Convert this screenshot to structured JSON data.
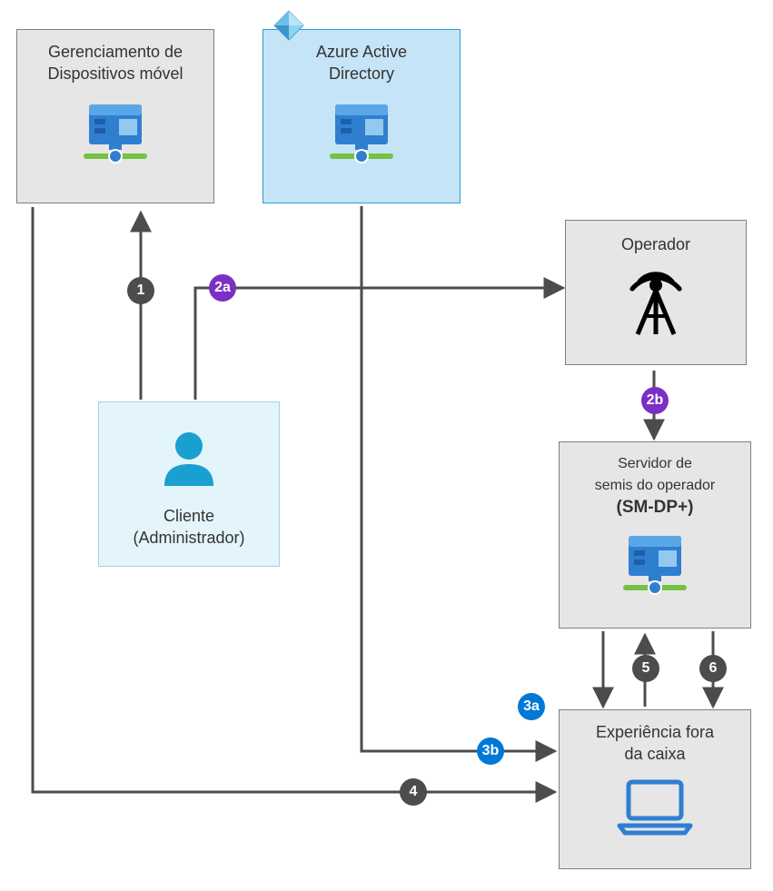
{
  "boxes": {
    "mdm": {
      "line1": "Gerenciamento de",
      "line2": "Dispositivos móvel"
    },
    "aad": {
      "line1": "Azure Active",
      "line2": "Directory"
    },
    "operator": {
      "line1": "Operador"
    },
    "cliente": {
      "line1": "Cliente",
      "line2": "(Administrador)"
    },
    "smdp": {
      "line1": "Servidor de",
      "line2": "semis do operador",
      "line3": "(SM-DP+)"
    },
    "oobe": {
      "line1": "Experiência fora",
      "line2": "da caixa"
    }
  },
  "steps": {
    "s1": "1",
    "s2a": "2a",
    "s2b": "2b",
    "s3a": "3a",
    "s3b": "3b",
    "s4": "4",
    "s5": "5",
    "s6": "6"
  },
  "colors": {
    "arrow": "#4c4c4c",
    "serverBody": "#2f7fd1",
    "serverTop": "#5aa7e8",
    "serverAccent": "#1f5fa8",
    "greenBar": "#76c043"
  }
}
